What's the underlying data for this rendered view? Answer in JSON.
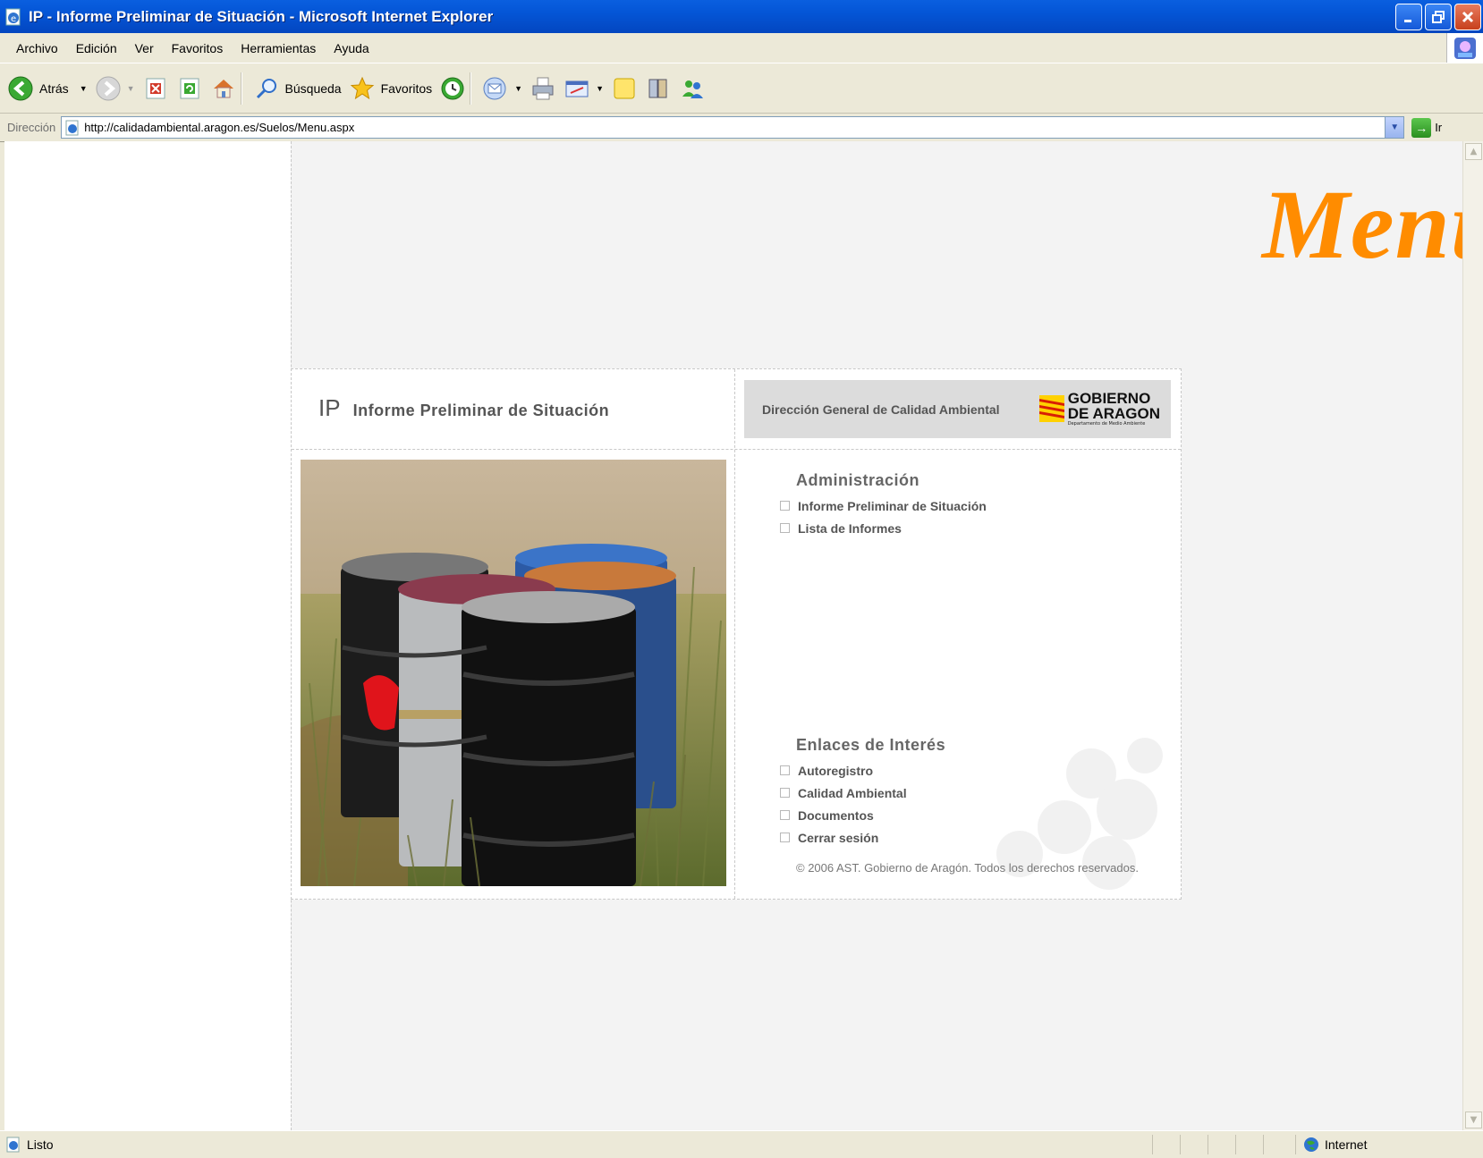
{
  "window": {
    "title": "IP - Informe Preliminar de Situación - Microsoft Internet Explorer"
  },
  "menubar": {
    "items": [
      {
        "label": "Archivo"
      },
      {
        "label": "Edición"
      },
      {
        "label": "Ver"
      },
      {
        "label": "Favoritos"
      },
      {
        "label": "Herramientas"
      },
      {
        "label": "Ayuda"
      }
    ]
  },
  "toolbar": {
    "back_label": "Atrás",
    "search_label": "Búsqueda",
    "favorites_label": "Favoritos"
  },
  "addressbar": {
    "label": "Dirección",
    "url": "http://calidadambiental.aragon.es/Suelos/Menu.aspx",
    "go_label": "Ir"
  },
  "page": {
    "heading": "Menu IP",
    "app_abbr": "IP",
    "app_name": "Informe Preliminar de Situación",
    "department": "Dirección General de Calidad Ambiental",
    "logo_line1": "GOBIERNO",
    "logo_line2": "DE ARAGON",
    "logo_small": "Departamento de Medio Ambiente",
    "admin_section": {
      "title": "Administración",
      "links": [
        {
          "label": "Informe Preliminar de Situación"
        },
        {
          "label": "Lista de Informes"
        }
      ]
    },
    "links_section": {
      "title": "Enlaces de Interés",
      "links": [
        {
          "label": "Autoregistro"
        },
        {
          "label": "Calidad Ambiental"
        },
        {
          "label": "Documentos"
        },
        {
          "label": "Cerrar sesión"
        }
      ]
    },
    "copyright": "© 2006 AST. Gobierno de Aragón. Todos los derechos reservados."
  },
  "statusbar": {
    "status": "Listo",
    "zone": "Internet"
  },
  "colors": {
    "heading": "#ff8c00",
    "titlebar": "#0455d6",
    "chrome": "#ece9d8"
  }
}
